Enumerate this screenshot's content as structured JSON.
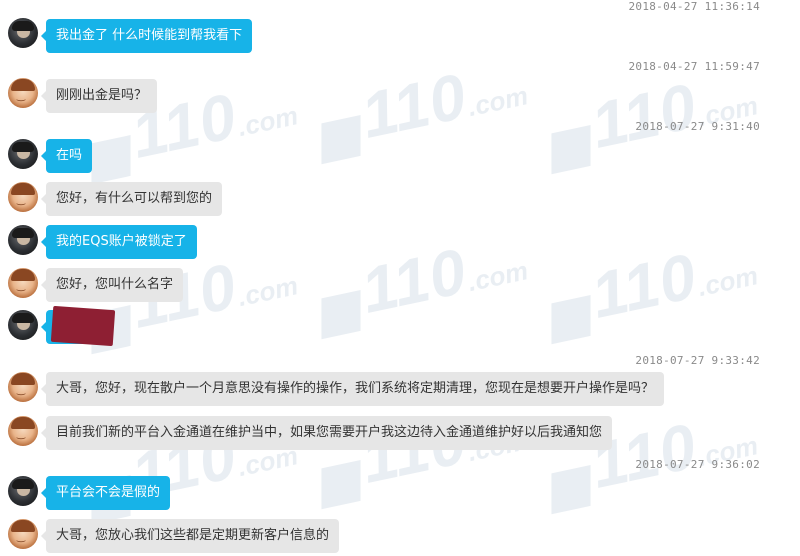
{
  "watermark": {
    "brand": "110",
    "suffix": ".com",
    "color": "#e9eef3"
  },
  "colors": {
    "user_bubble": "#17b3e8",
    "agent_bubble": "#e6e6e6",
    "timestamp": "#8a8a8a",
    "redaction": "#8e1f33"
  },
  "timestamps": [
    "2018-04-27 11:36:14",
    "2018-04-27 11:59:47",
    "2018-07-27 9:31:40",
    "2018-07-27 9:33:42",
    "2018-07-27 9:36:02"
  ],
  "messages": [
    {
      "sender": "user",
      "avatar": "user-avatar",
      "text": "我出金了 什么时候能到帮我看下"
    },
    {
      "sender": "agent",
      "avatar": "agent-avatar",
      "text": "刚刚出金是吗？"
    },
    {
      "sender": "user",
      "avatar": "user-avatar",
      "text": "在吗"
    },
    {
      "sender": "agent",
      "avatar": "agent-avatar",
      "text": "您好，有什么可以帮到您的"
    },
    {
      "sender": "user",
      "avatar": "user-avatar",
      "text": "我的EQS账户被锁定了"
    },
    {
      "sender": "agent",
      "avatar": "agent-avatar",
      "text": "您好，您叫什么名字"
    },
    {
      "sender": "user",
      "avatar": "user-avatar",
      "text": "",
      "redacted": true
    },
    {
      "sender": "agent",
      "avatar": "agent-avatar",
      "text": "大哥，您好，现在散户一个月意思没有操作的操作，我们系统将定期清理，您现在是想要开户操作是吗？"
    },
    {
      "sender": "agent",
      "avatar": "agent-avatar",
      "text": "目前我们新的平台入金通道在维护当中，如果您需要开户我这边待入金通道维护好以后我通知您"
    },
    {
      "sender": "user",
      "avatar": "user-avatar",
      "text": "平台会不会是假的"
    },
    {
      "sender": "agent",
      "avatar": "agent-avatar",
      "text": "大哥，您放心我们这些都是定期更新客户信息的"
    }
  ]
}
